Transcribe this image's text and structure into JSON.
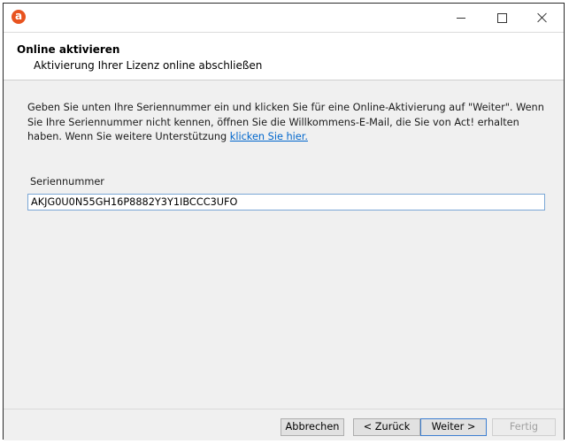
{
  "window": {
    "app_icon_letter": "a",
    "controls": {
      "minimize": "minimize",
      "maximize": "maximize",
      "close": "close"
    }
  },
  "header": {
    "title": "Online aktivieren",
    "subtitle": "Aktivierung Ihrer Lizenz online abschließen"
  },
  "body": {
    "instruction_text": "Geben Sie unten Ihre Seriennummer ein und klicken Sie für eine Online-Aktivierung auf \"Weiter\". Wenn Sie Ihre Seriennummer nicht kennen, öffnen Sie die Willkommens-E-Mail, die Sie von Act! erhalten haben. Wenn Sie weitere Unterstützung ",
    "help_link": "klicken Sie hier."
  },
  "serial": {
    "label": "Seriennummer",
    "value": "AKJG0U0N55GH16P8882Y3Y1IBCCC3UFO"
  },
  "footer": {
    "cancel_label": "Abbrechen",
    "back_label": "< Zurück",
    "next_label": "Weiter >",
    "finish_label": "Fertig"
  }
}
